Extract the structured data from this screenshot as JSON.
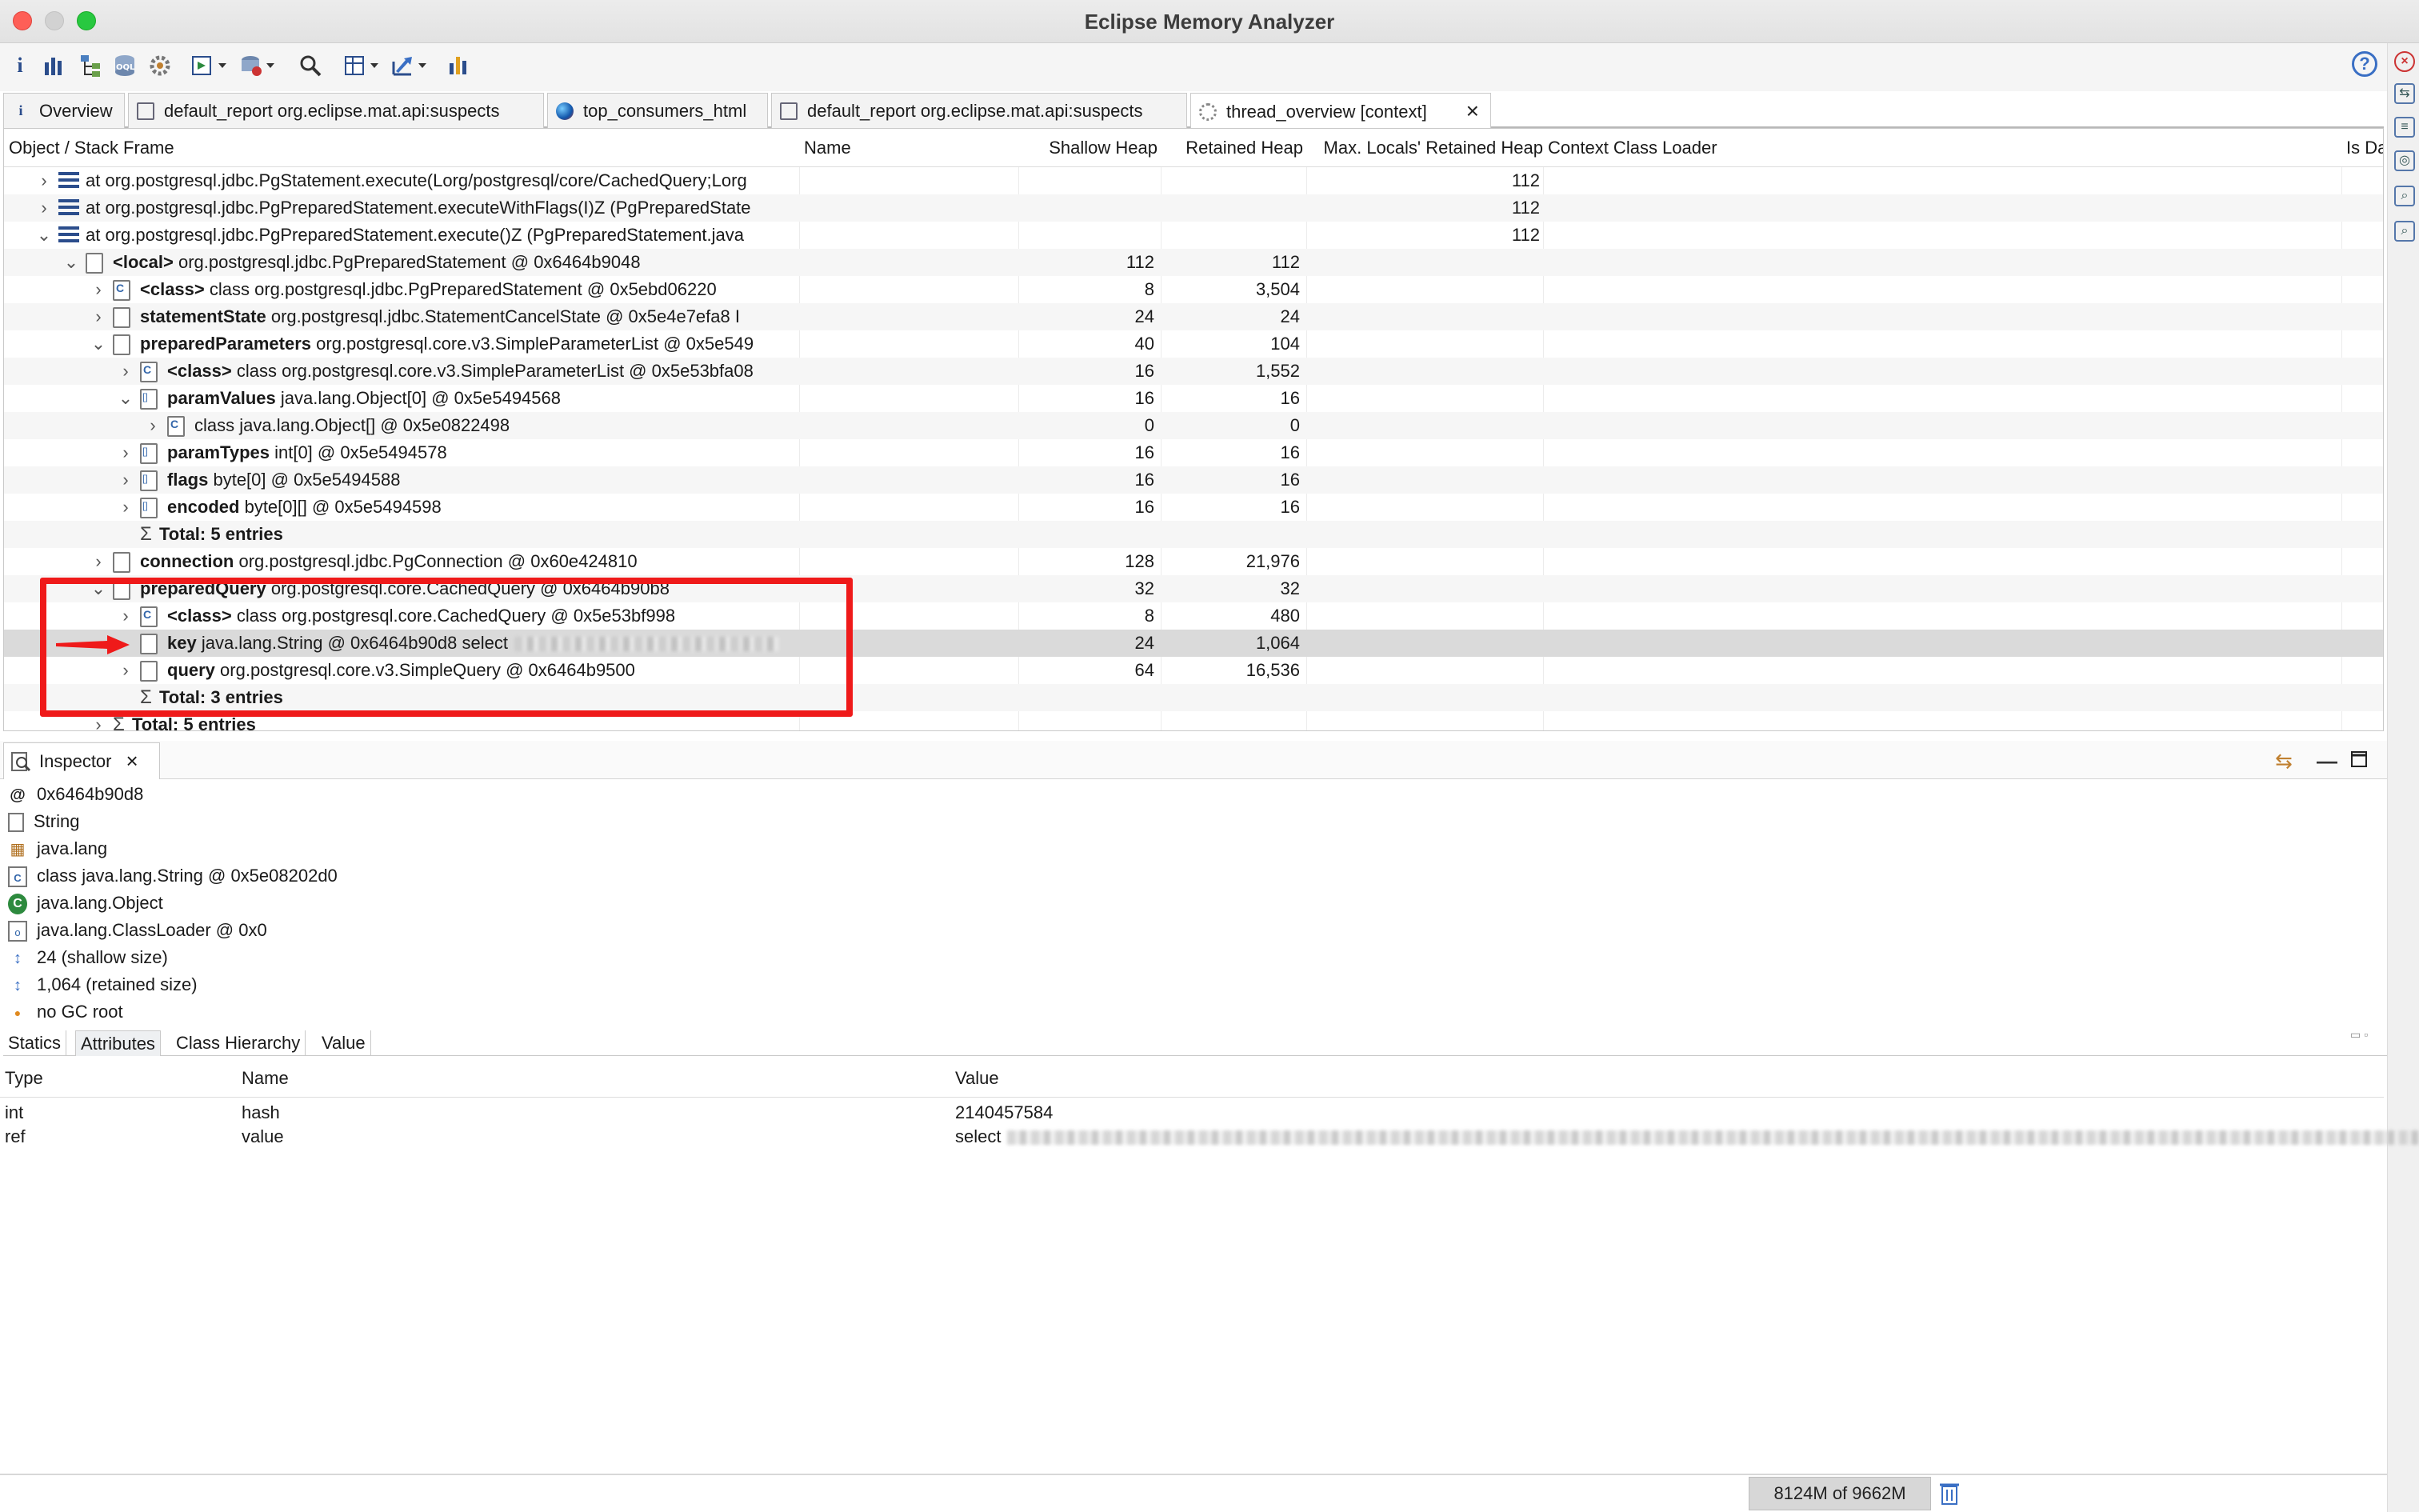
{
  "window": {
    "title": "Eclipse Memory Analyzer"
  },
  "toolbar": {
    "icons": [
      "info-icon",
      "histogram-icon",
      "dominator-tree-icon",
      "oql-icon",
      "thread-overview-icon",
      "run-report-icon",
      "query-browser-icon",
      "find-object-icon",
      "group-result-icon",
      "export-icon",
      "heap-dump-overview-icon",
      "help-icon"
    ]
  },
  "tabs": [
    {
      "label": "Overview",
      "icon": "info-icon"
    },
    {
      "label": "default_report  org.eclipse.mat.api:suspects",
      "icon": "report-icon"
    },
    {
      "label": "top_consumers_html",
      "icon": "globe-icon"
    },
    {
      "label": "default_report  org.eclipse.mat.api:suspects",
      "icon": "report-icon"
    },
    {
      "label": "thread_overview  [context]",
      "icon": "gear-icon",
      "closable": true
    }
  ],
  "table": {
    "columns": [
      "Object / Stack Frame",
      "Name",
      "Shallow Heap",
      "Retained Heap",
      "Max. Locals' Retained Heap",
      "Context Class Loader",
      "Is Da"
    ],
    "rows": [
      {
        "kind": "frame",
        "depth": 0,
        "expander": "collapsed",
        "bold": "",
        "text": "at org.postgresql.jdbc.PgStatement.execute(Lorg/postgresql/core/CachedQuery;Lorg",
        "shallow": "",
        "retained": "",
        "maxlocals": "112"
      },
      {
        "kind": "frame",
        "depth": 0,
        "expander": "collapsed",
        "bold": "",
        "text": "at org.postgresql.jdbc.PgPreparedStatement.executeWithFlags(I)Z (PgPreparedState",
        "shallow": "",
        "retained": "",
        "maxlocals": "112"
      },
      {
        "kind": "frame",
        "depth": 0,
        "expander": "expanded",
        "bold": "",
        "text": "at org.postgresql.jdbc.PgPreparedStatement.execute()Z (PgPreparedStatement.java",
        "shallow": "",
        "retained": "",
        "maxlocals": "112"
      },
      {
        "kind": "obj",
        "depth": 1,
        "expander": "expanded",
        "bold": "<local>",
        "text": " org.postgresql.jdbc.PgPreparedStatement @ 0x6464b9048",
        "shallow": "112",
        "retained": "112",
        "maxlocals": ""
      },
      {
        "kind": "class",
        "depth": 2,
        "expander": "collapsed",
        "bold": "<class>",
        "text": " class org.postgresql.jdbc.PgPreparedStatement @ 0x5ebd06220",
        "shallow": "8",
        "retained": "3,504",
        "maxlocals": ""
      },
      {
        "kind": "obj",
        "depth": 2,
        "expander": "collapsed",
        "bold": "statementState",
        "text": "  org.postgresql.jdbc.StatementCancelState @ 0x5e4e7efa8  I",
        "shallow": "24",
        "retained": "24",
        "maxlocals": ""
      },
      {
        "kind": "obj",
        "depth": 2,
        "expander": "expanded",
        "bold": "preparedParameters",
        "text": "  org.postgresql.core.v3.SimpleParameterList @ 0x5e549",
        "shallow": "40",
        "retained": "104",
        "maxlocals": ""
      },
      {
        "kind": "class",
        "depth": 3,
        "expander": "collapsed",
        "bold": "<class>",
        "text": " class org.postgresql.core.v3.SimpleParameterList @ 0x5e53bfa08",
        "shallow": "16",
        "retained": "1,552",
        "maxlocals": ""
      },
      {
        "kind": "arr",
        "depth": 3,
        "expander": "expanded",
        "bold": "paramValues",
        "text": "  java.lang.Object[0] @ 0x5e5494568",
        "shallow": "16",
        "retained": "16",
        "maxlocals": ""
      },
      {
        "kind": "class",
        "depth": 4,
        "expander": "collapsed",
        "bold": "",
        "text": "class java.lang.Object[] @ 0x5e0822498",
        "shallow": "0",
        "retained": "0",
        "maxlocals": ""
      },
      {
        "kind": "arr",
        "depth": 3,
        "expander": "collapsed",
        "bold": "paramTypes",
        "text": "  int[0] @ 0x5e5494578",
        "shallow": "16",
        "retained": "16",
        "maxlocals": ""
      },
      {
        "kind": "arr",
        "depth": 3,
        "expander": "collapsed",
        "bold": "flags",
        "text": "  byte[0] @ 0x5e5494588",
        "shallow": "16",
        "retained": "16",
        "maxlocals": ""
      },
      {
        "kind": "arr",
        "depth": 3,
        "expander": "collapsed",
        "bold": "encoded",
        "text": "  byte[0][] @ 0x5e5494598",
        "shallow": "16",
        "retained": "16",
        "maxlocals": ""
      },
      {
        "kind": "total",
        "depth": 3,
        "expander": "none",
        "bold": "Total: 5 entries",
        "text": "",
        "shallow": "",
        "retained": "",
        "maxlocals": ""
      },
      {
        "kind": "obj",
        "depth": 2,
        "expander": "collapsed",
        "bold": "connection",
        "text": "  org.postgresql.jdbc.PgConnection @ 0x60e424810",
        "shallow": "128",
        "retained": "21,976",
        "maxlocals": ""
      },
      {
        "kind": "obj",
        "depth": 2,
        "expander": "expanded",
        "bold": "preparedQuery",
        "text": "  org.postgresql.core.CachedQuery @ 0x6464b90b8",
        "shallow": "32",
        "retained": "32",
        "maxlocals": ""
      },
      {
        "kind": "class",
        "depth": 3,
        "expander": "collapsed",
        "bold": "<class>",
        "text": " class org.postgresql.core.CachedQuery @ 0x5e53bf998",
        "shallow": "8",
        "retained": "480",
        "maxlocals": ""
      },
      {
        "kind": "obj",
        "depth": 3,
        "expander": "none",
        "bold": "key",
        "text": "  java.lang.String @ 0x6464b90d8  select",
        "shallow": "24",
        "retained": "1,064",
        "maxlocals": "",
        "selected": true,
        "redacted": true
      },
      {
        "kind": "obj",
        "depth": 3,
        "expander": "collapsed",
        "bold": "query",
        "text": "  org.postgresql.core.v3.SimpleQuery @ 0x6464b9500",
        "shallow": "64",
        "retained": "16,536",
        "maxlocals": ""
      },
      {
        "kind": "total",
        "depth": 3,
        "expander": "none",
        "bold": "Total: 3 entries",
        "text": "",
        "shallow": "",
        "retained": "",
        "maxlocals": ""
      },
      {
        "kind": "total",
        "depth": 2,
        "expander": "collapsed",
        "bold": "Total: 5 entries",
        "text": "",
        "shallow": "",
        "retained": "",
        "maxlocals": ""
      }
    ]
  },
  "annotation": {
    "color": "#ef1a1a"
  },
  "inspector": {
    "tab_label": "Inspector",
    "items": [
      {
        "icon": "at-icon",
        "text": "0x6464b90d8"
      },
      {
        "icon": "file-icon",
        "text": "String"
      },
      {
        "icon": "package-icon",
        "text": "java.lang"
      },
      {
        "icon": "class-icon",
        "text": "class java.lang.String @ 0x5e08202d0"
      },
      {
        "icon": "superclass-icon",
        "text": "java.lang.Object"
      },
      {
        "icon": "classloader-icon",
        "text": "java.lang.ClassLoader @ 0x0"
      },
      {
        "icon": "shallow-size-icon",
        "text": "24 (shallow size)"
      },
      {
        "icon": "retained-size-icon",
        "text": "1,064 (retained size)"
      },
      {
        "icon": "gc-root-icon",
        "text": "no GC root"
      }
    ],
    "subtabs": [
      "Statics",
      "Attributes",
      "Class Hierarchy",
      "Value"
    ],
    "active_subtab": "Attributes",
    "attr_columns": [
      "Type",
      "Name",
      "Value"
    ],
    "attributes": [
      {
        "type": "int",
        "name": "hash",
        "value": "2140457584"
      },
      {
        "type": "ref",
        "name": "value",
        "value": "select"
      }
    ]
  },
  "status": {
    "heap": "8124M of 9662M"
  }
}
